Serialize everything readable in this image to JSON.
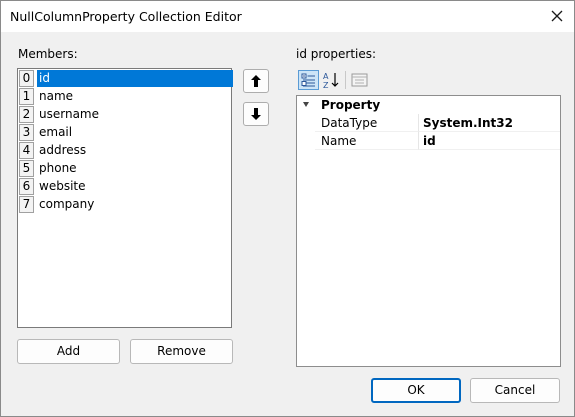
{
  "window": {
    "title": "NullColumnProperty Collection Editor"
  },
  "members": {
    "label": "Members:",
    "items": [
      {
        "index": "0",
        "name": "id",
        "selected": true
      },
      {
        "index": "1",
        "name": "name"
      },
      {
        "index": "2",
        "name": "username"
      },
      {
        "index": "3",
        "name": "email"
      },
      {
        "index": "4",
        "name": "address"
      },
      {
        "index": "5",
        "name": "phone"
      },
      {
        "index": "6",
        "name": "website"
      },
      {
        "index": "7",
        "name": "company"
      }
    ],
    "add_label": "Add",
    "remove_label": "Remove"
  },
  "properties": {
    "label": "id properties:",
    "category": "Property",
    "rows": [
      {
        "name": "DataType",
        "value": "System.Int32"
      },
      {
        "name": "Name",
        "value": "id"
      }
    ]
  },
  "footer": {
    "ok_label": "OK",
    "cancel_label": "Cancel"
  },
  "colors": {
    "selection": "#0078d7",
    "default_button_border": "#0067c0"
  },
  "icons": {
    "move_up": "arrow-up-icon",
    "move_down": "arrow-down-icon",
    "categorized": "categorized-icon",
    "alphabetical": "sort-alphabetical-icon",
    "property_pages": "property-pages-icon",
    "close": "close-icon"
  }
}
